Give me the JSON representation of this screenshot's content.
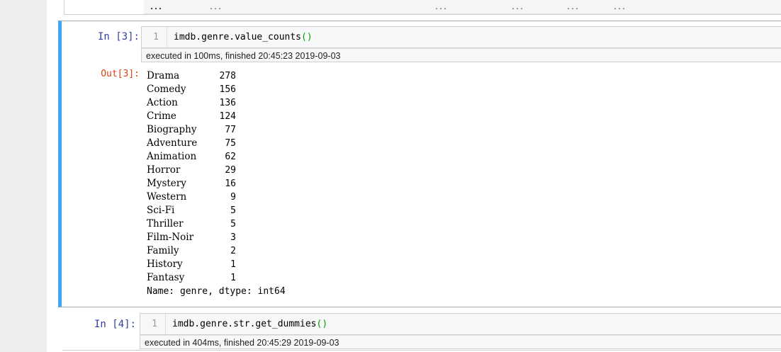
{
  "prev_cell": {
    "dots": [
      "...",
      "...",
      "...",
      "...",
      "...",
      "..."
    ]
  },
  "cell3": {
    "prompt_in": "In  [3]:",
    "line_number": "1",
    "code": "imdb.genre.value_counts",
    "code_parens": "()",
    "exec_info": "executed in 100ms, finished 20:45:23 2019-09-03",
    "prompt_out": "Out[3]:",
    "output": {
      "rows": [
        {
          "label": "Drama",
          "count": "278"
        },
        {
          "label": "Comedy",
          "count": "156"
        },
        {
          "label": "Action",
          "count": "136"
        },
        {
          "label": "Crime",
          "count": "124"
        },
        {
          "label": "Biography",
          "count": "77"
        },
        {
          "label": "Adventure",
          "count": "75"
        },
        {
          "label": "Animation",
          "count": "62"
        },
        {
          "label": "Horror",
          "count": "29"
        },
        {
          "label": "Mystery",
          "count": "16"
        },
        {
          "label": "Western",
          "count": "9"
        },
        {
          "label": "Sci-Fi",
          "count": "5"
        },
        {
          "label": "Thriller",
          "count": "5"
        },
        {
          "label": "Film-Noir",
          "count": "3"
        },
        {
          "label": "Family",
          "count": "2"
        },
        {
          "label": "History",
          "count": "1"
        },
        {
          "label": "Fantasy",
          "count": "1"
        }
      ],
      "footer": "Name: genre, dtype: int64"
    }
  },
  "cell4": {
    "prompt_in": "In  [4]:",
    "line_number": "1",
    "code": "imdb.genre.str.get_dummies",
    "code_parens": "()",
    "exec_info": "executed in 404ms, finished 20:45:29 2019-09-03"
  },
  "colors": {
    "selected_cell_border": "#42a5f5",
    "prompt_in": "#303f9f",
    "prompt_out": "#d84315",
    "paren": "#00a000"
  }
}
